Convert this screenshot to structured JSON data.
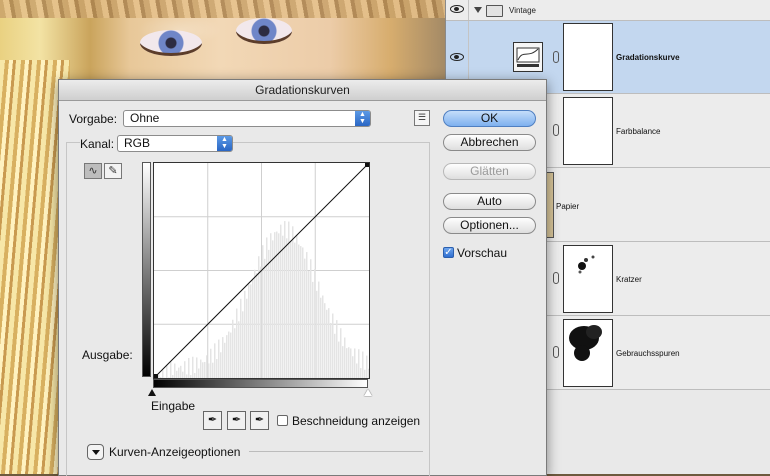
{
  "dialog": {
    "title": "Gradationskurven",
    "preset_label": "Vorgabe:",
    "preset_value": "Ohne",
    "channel_label": "Kanal:",
    "channel_value": "RGB",
    "output_label": "Ausgabe:",
    "input_label": "Eingabe",
    "clipping_label": "Beschneidung anzeigen",
    "display_options_label": "Kurven-Anzeigeoptionen",
    "preview_label": "Vorschau",
    "preview_checked": true,
    "buttons": {
      "ok": "OK",
      "cancel": "Abbrechen",
      "smooth": "Glätten",
      "auto": "Auto",
      "options": "Optionen..."
    },
    "icons": {
      "curve_tool": "curve-point-icon",
      "pencil_tool": "pencil-icon",
      "black_dropper": "eyedropper-black-icon",
      "gray_dropper": "eyedropper-gray-icon",
      "white_dropper": "eyedropper-white-icon",
      "preset_menu": "preset-menu-icon"
    }
  },
  "layers": {
    "group_name": "Vintage",
    "items": [
      {
        "name": "Gradationskurve",
        "selected": true
      },
      {
        "name": "Farbbalance",
        "selected": false
      },
      {
        "name": "Papier",
        "selected": false
      },
      {
        "name": "Kratzer",
        "selected": false
      },
      {
        "name": "Gebrauchsspuren",
        "selected": false
      }
    ]
  },
  "colors": {
    "selected_layer": "#c3d7ef",
    "default_button": "#7eb0ef",
    "select_arrows": "#2a66c4"
  }
}
